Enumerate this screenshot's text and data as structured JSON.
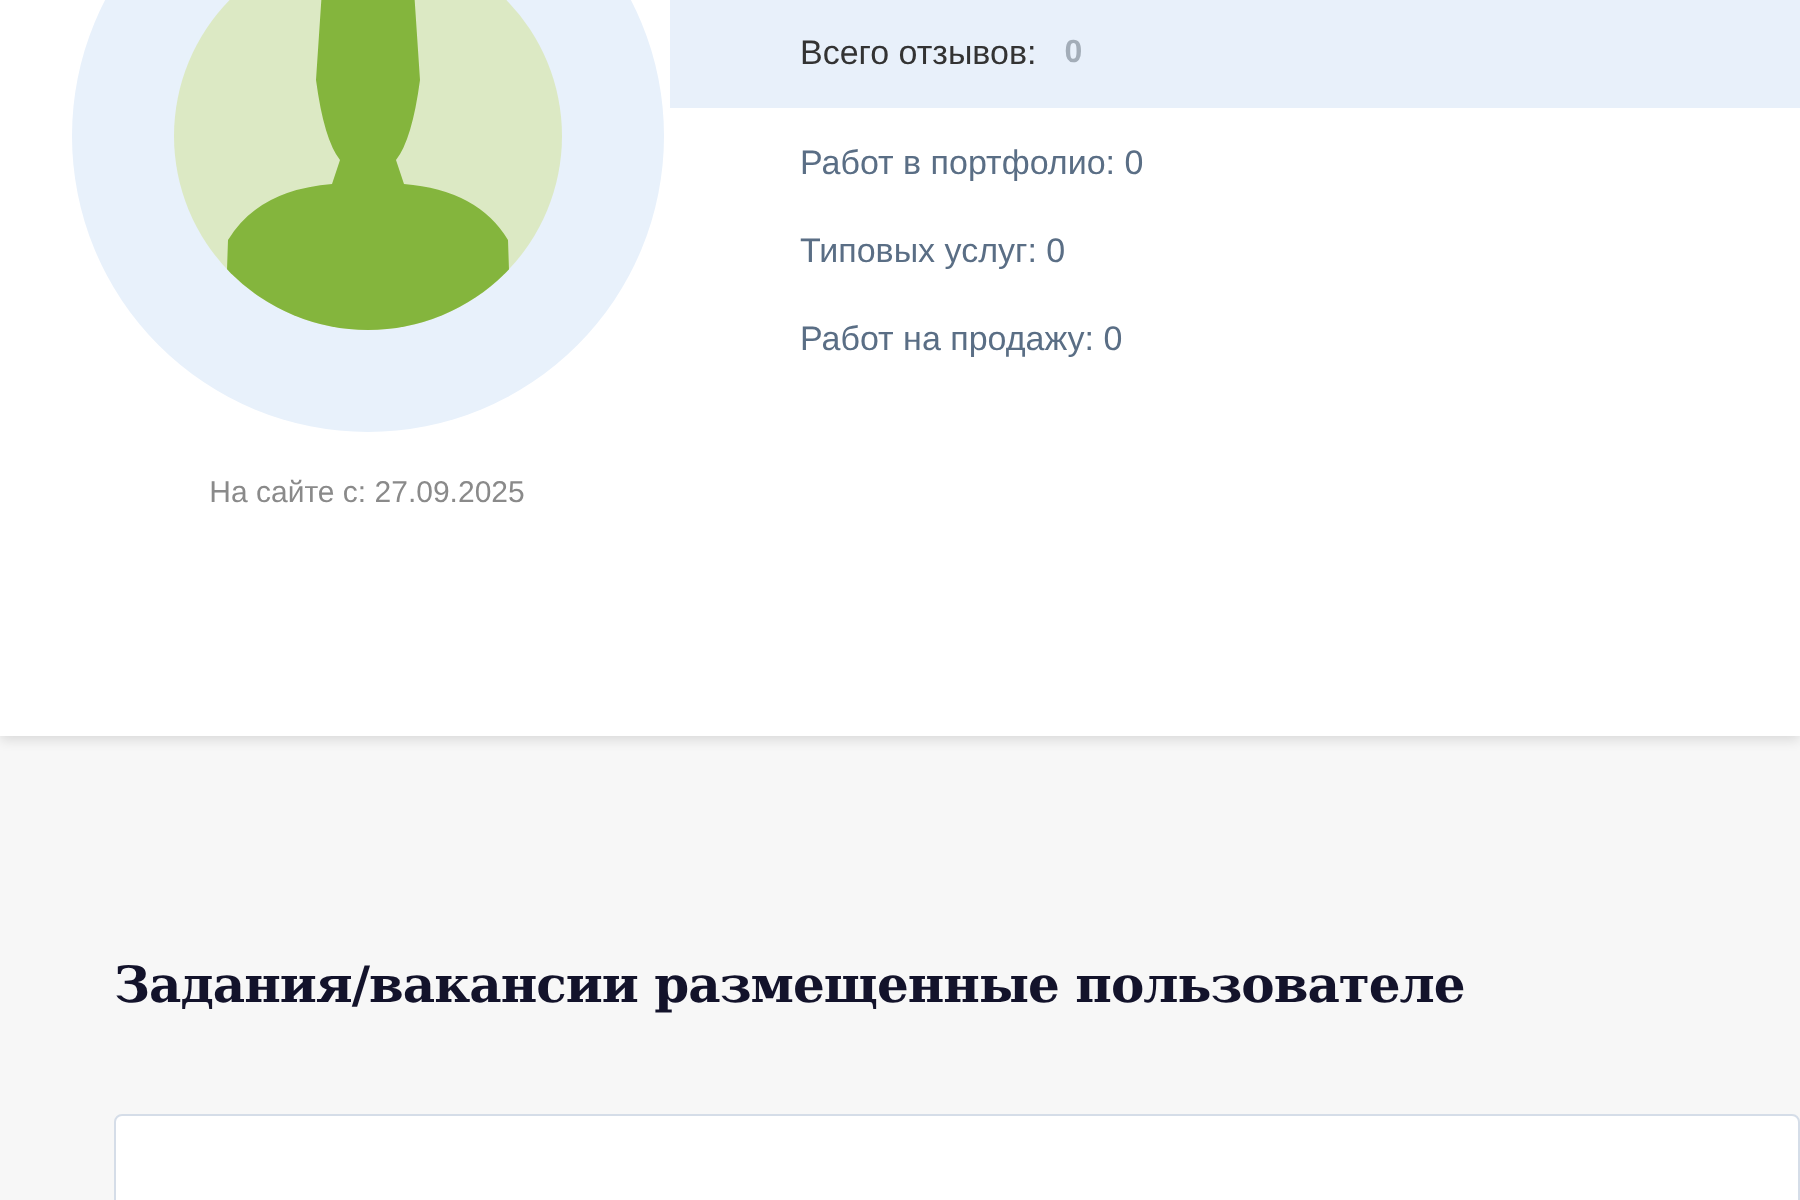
{
  "profile": {
    "member_since": "На сайте с: 27.09.2025"
  },
  "reviews": {
    "label": "Всего отзывов:",
    "value": "0"
  },
  "stats": [
    "Работ в портфолио: 0",
    "Типовых услуг: 0",
    "Работ на продажу: 0"
  ],
  "section": {
    "title": "Задания/вакансии размещенные пользователе"
  }
}
